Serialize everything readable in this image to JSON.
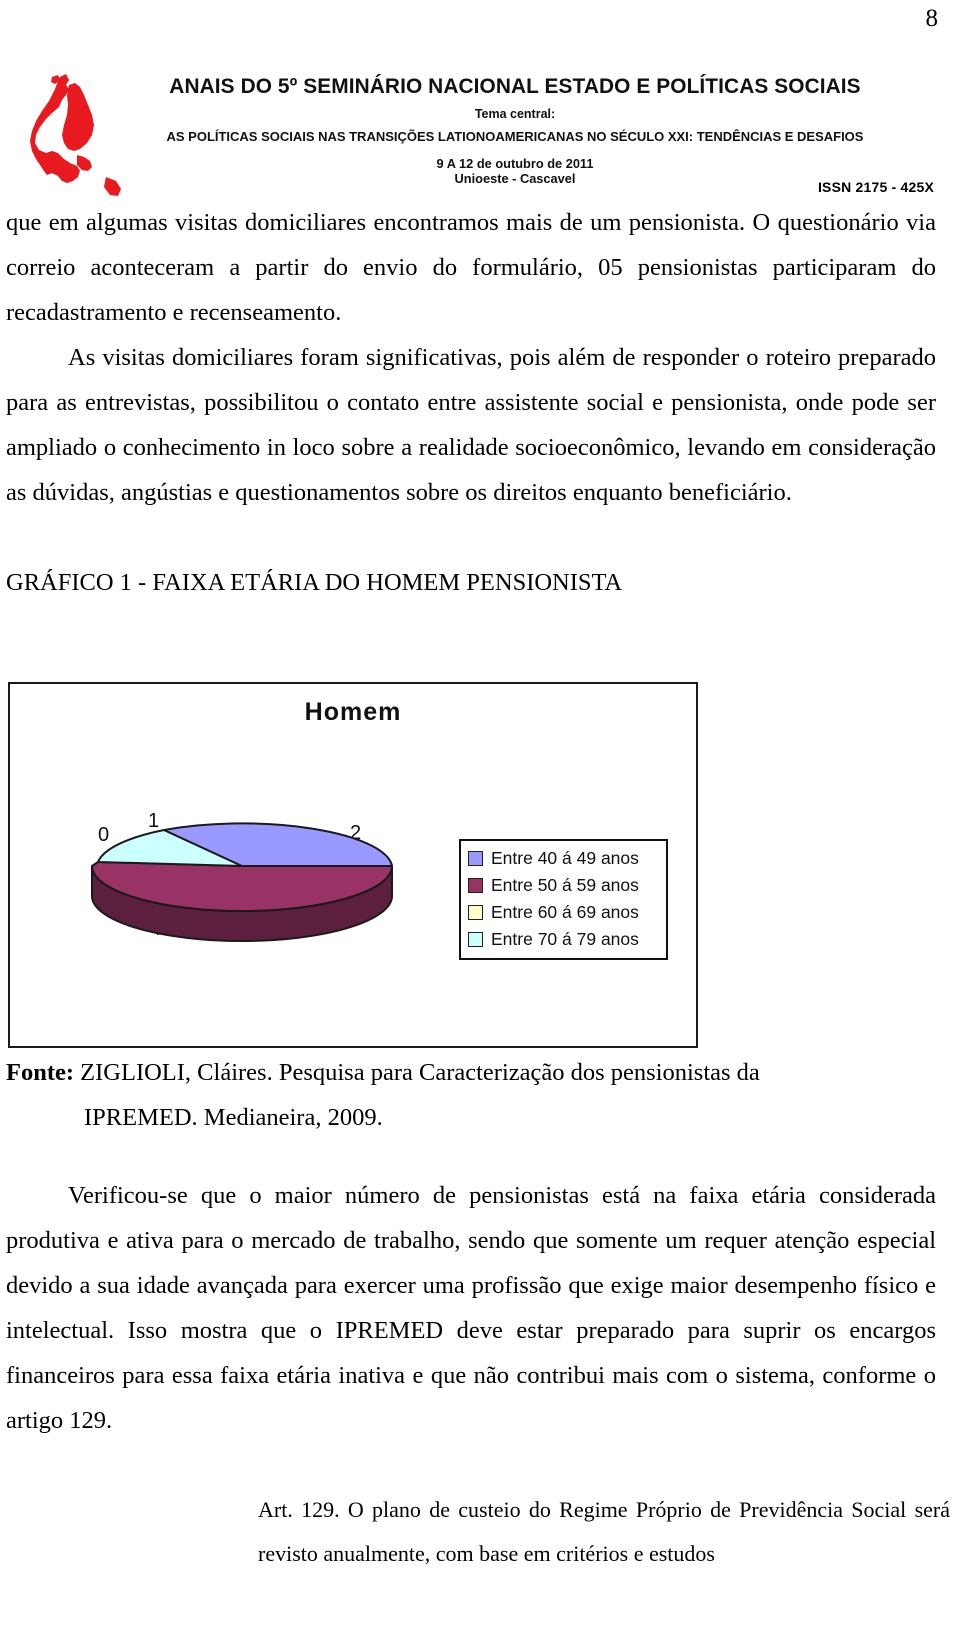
{
  "page": {
    "number": "8"
  },
  "header": {
    "logo_icon": "south-america-map-icon",
    "title": "ANAIS DO 5º SEMINÁRIO NACIONAL ESTADO E POLÍTICAS SOCIAIS",
    "subtitle_label": "Tema central:",
    "theme": "AS POLÍTICAS SOCIAIS NAS TRANSIÇÕES LATIONOAMERICANAS NO SÉCULO XXI: TENDÊNCIAS E DESAFIOS",
    "date_line": "9 A 12 de outubro de 2011",
    "venue_line": "Unioeste - Cascavel",
    "issn": "ISSN 2175 - 425X"
  },
  "body": {
    "paragraph_1": "que em algumas visitas domiciliares encontramos mais de um pensionista. O questionário via correio aconteceram a partir do envio do formulário, 05 pensionistas participaram do recadastramento e recenseamento.",
    "paragraph_2": "As visitas domiciliares foram significativas, pois além de responder o roteiro preparado para as entrevistas, possibilitou o contato entre assistente social e pensionista, onde pode ser ampliado o conhecimento in loco sobre a realidade socioeconômico, levando em consideração as dúvidas, angústias e questionamentos sobre os direitos enquanto beneficiário.",
    "figure_caption": "GRÁFICO 1 - FAIXA ETÁRIA DO HOMEM PENSIONISTA",
    "fonte_label": "Fonte:",
    "fonte_text": " ZIGLIOLI, Cláires. Pesquisa para Caracterização dos pensionistas da",
    "fonte_text_line2": "IPREMED. Medianeira, 2009.",
    "paragraph_3": "Verificou-se que o maior número de pensionistas está na faixa etária considerada produtiva e ativa para o mercado de trabalho, sendo que somente um requer atenção especial devido a sua idade avançada para exercer uma profissão que exige maior desempenho físico e intelectual. Isso mostra que o IPREMED deve estar preparado para suprir os encargos financeiros para essa faixa etária inativa e que não contribui mais com o sistema, conforme o artigo 129.",
    "quote": "Art. 129. O plano de custeio do Regime Próprio de Previdência Social será revisto anualmente, com base em critérios e estudos"
  },
  "chart_data": {
    "type": "pie",
    "title": "Homem",
    "categories": [
      "Entre 40 á 49 anos",
      "Entre 50 á 59 anos",
      "Entre 60 á 69 anos",
      "Entre 70 á 79 anos"
    ],
    "values": [
      2,
      4,
      0,
      1
    ],
    "data_labels": [
      "2",
      "4",
      "0",
      "1"
    ],
    "colors": [
      "#9999ff",
      "#993366",
      "#ffffcc",
      "#ccffff"
    ],
    "legend_position": "right",
    "three_d": true,
    "xlabel": "",
    "ylabel": "",
    "grid": false
  },
  "legend": [
    {
      "label": "Entre 40 á 49 anos",
      "color": "#9999ff"
    },
    {
      "label": "Entre 50 á 59 anos",
      "color": "#993366"
    },
    {
      "label": "Entre 60 á 69 anos",
      "color": "#ffffcc"
    },
    {
      "label": "Entre 70 á 79 anos",
      "color": "#ccffff"
    }
  ],
  "pie_labels": {
    "zero": "0",
    "one": "1",
    "two": "2",
    "four": "4"
  }
}
